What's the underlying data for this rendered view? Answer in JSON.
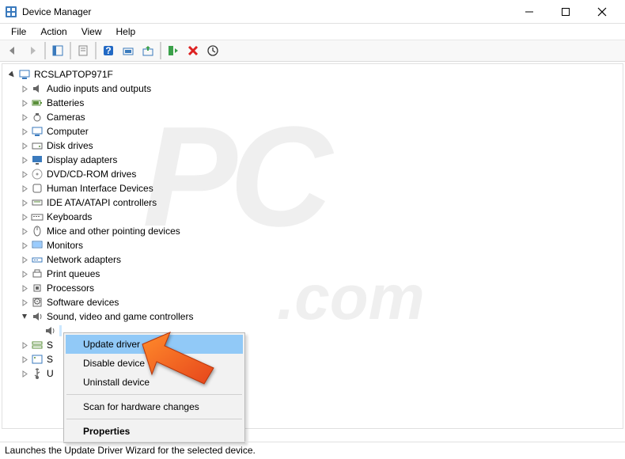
{
  "window": {
    "title": "Device Manager"
  },
  "menubar": {
    "file": "File",
    "action": "Action",
    "view": "View",
    "help": "Help"
  },
  "tree": {
    "root": "RCSLAPTOP971F",
    "nodes": [
      {
        "label": "Audio inputs and outputs",
        "icon": "speaker"
      },
      {
        "label": "Batteries",
        "icon": "battery"
      },
      {
        "label": "Cameras",
        "icon": "camera"
      },
      {
        "label": "Computer",
        "icon": "computer"
      },
      {
        "label": "Disk drives",
        "icon": "disk"
      },
      {
        "label": "Display adapters",
        "icon": "display"
      },
      {
        "label": "DVD/CD-ROM drives",
        "icon": "dvd"
      },
      {
        "label": "Human Interface Devices",
        "icon": "hid"
      },
      {
        "label": "IDE ATA/ATAPI controllers",
        "icon": "ide"
      },
      {
        "label": "Keyboards",
        "icon": "keyboard"
      },
      {
        "label": "Mice and other pointing devices",
        "icon": "mouse"
      },
      {
        "label": "Monitors",
        "icon": "monitor"
      },
      {
        "label": "Network adapters",
        "icon": "network"
      },
      {
        "label": "Print queues",
        "icon": "printer"
      },
      {
        "label": "Processors",
        "icon": "cpu"
      },
      {
        "label": "Software devices",
        "icon": "software"
      },
      {
        "label": "Sound, video and game controllers",
        "icon": "sound",
        "expanded": true
      },
      {
        "label": "S",
        "icon": "storage",
        "partial": true
      },
      {
        "label": "S",
        "icon": "system",
        "partial": true
      },
      {
        "label": "U",
        "icon": "usb",
        "partial": true
      }
    ]
  },
  "context_menu": {
    "update_driver": "Update driver",
    "disable_device": "Disable device",
    "uninstall_device": "Uninstall device",
    "scan_hardware": "Scan for hardware changes",
    "properties": "Properties"
  },
  "statusbar": {
    "text": "Launches the Update Driver Wizard for the selected device."
  }
}
